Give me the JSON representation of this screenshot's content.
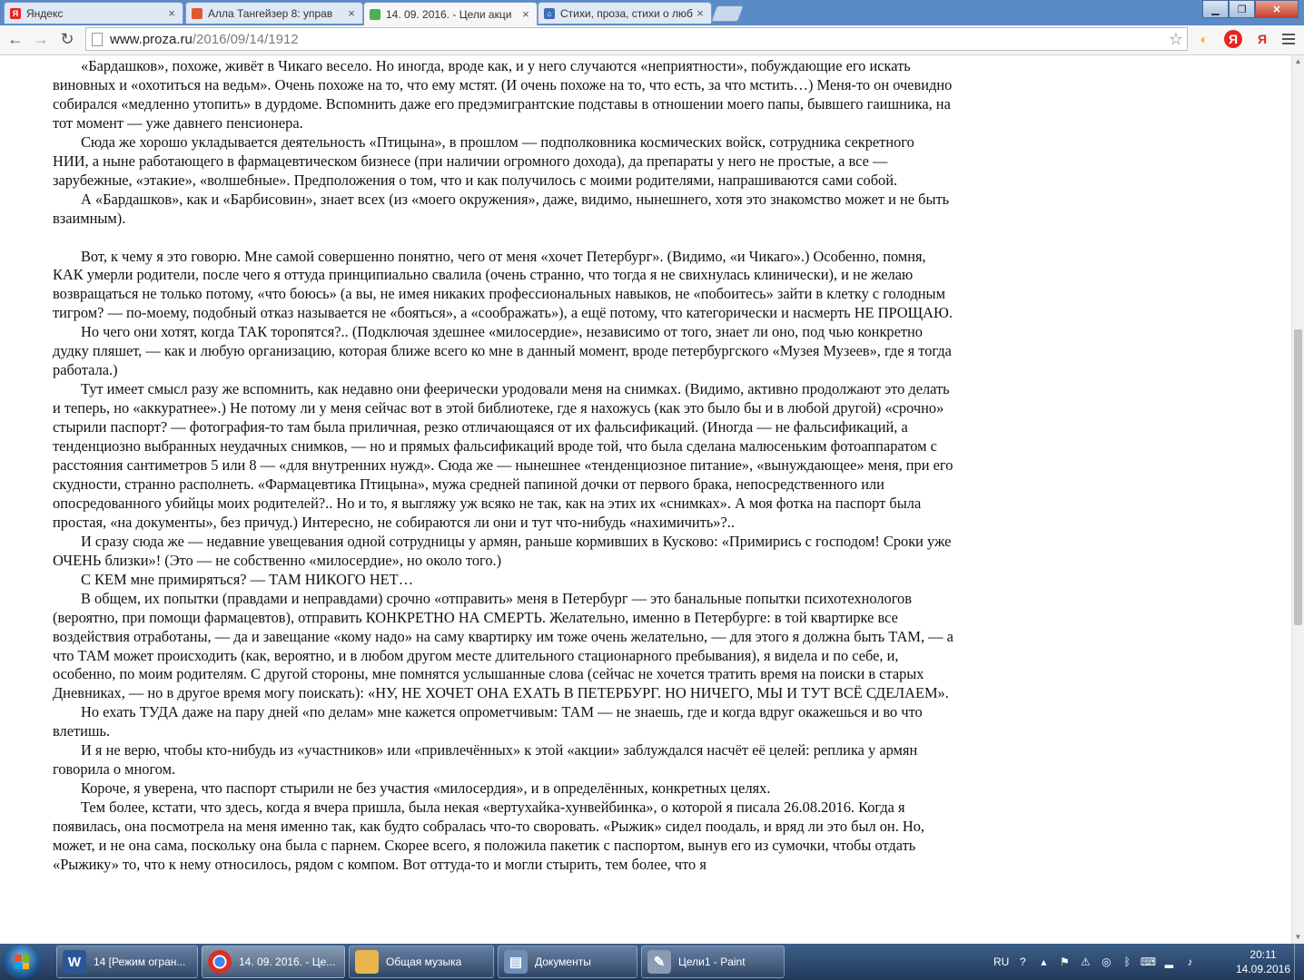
{
  "browser": {
    "tabs": [
      {
        "title": "Яндекс",
        "icon": "yandex-icon",
        "color": "#e52620",
        "active": false
      },
      {
        "title": "Алла Тангейзер 8: управ",
        "icon": "proza-icon",
        "color": "#e0582c",
        "active": false
      },
      {
        "title": "14. 09. 2016. - Цели акци",
        "icon": "proza-icon",
        "color": "#4caf50",
        "active": true
      },
      {
        "title": "Стихи, проза, стихи о люб",
        "icon": "home-icon",
        "color": "#3b6db3",
        "active": false
      }
    ],
    "url_host": "www.proza.ru",
    "url_path": "/2016/09/14/1912"
  },
  "article": {
    "paragraphs": [
      "«Бардашков», похоже, живёт в Чикаго весело. Но иногда, вроде как, и у него случаются «неприятности», побуждающие его искать виновных и «охотиться на ведьм». Очень похоже на то, что ему мстят. (И очень похоже на то, что есть, за что мстить…) Меня-то он очевидно собирался «медленно утопить» в дурдоме. Вспомнить даже его предэмигрантские подставы в отношении моего папы, бывшего гаишника, на тот момент — уже давнего пенсионера.",
      "Сюда же хорошо укладывается деятельность «Птицына», в прошлом — подполковника космических войск, сотрудника секретного НИИ, а ныне работающего в фармацевтическом бизнесе (при наличии огромного дохода), да препараты у него не простые, а все — зарубежные, «этакие», «волшебные». Предположения о том, что и как получилось с моими родителями, напрашиваются сами собой.",
      "А «Бардашков», как и «Барбисовин», знает всех (из «моего окружения», даже, видимо, нынешнего, хотя это знакомство может и не быть взаимным).",
      "",
      "Вот, к чему я это говорю. Мне самой совершенно понятно, чего от меня «хочет Петербург». (Видимо, «и Чикаго».) Особенно, помня, КАК умерли родители, после чего я оттуда принципиально свалила (очень странно, что тогда я не свихнулась клинически), и не желаю возвращаться не только потому, «что боюсь» (а вы, не имея никаких профессиональных навыков, не «побоитесь» зайти в клетку с голодным тигром? — по-моему, подобный отказ называется не «бояться», а «соображать»), а ещё потому, что категорически и насмерть НЕ ПРОЩАЮ.",
      "Но чего они хотят, когда ТАК торопятся?.. (Подключая здешнее «милосердие», независимо от того, знает ли оно, под чью конкретно дудку пляшет, — как и любую организацию, которая ближе всего ко мне в данный момент, вроде петербургского «Музея Музеев», где я тогда работала.)",
      "Тут имеет смысл разу же вспомнить, как недавно они феерически уродовали меня на снимках. (Видимо, активно продолжают это делать и теперь, но «аккуратнее».) Не потому ли у меня сейчас вот в этой библиотеке, где я нахожусь (как это было бы и в любой другой) «срочно» стырили паспорт? — фотография-то там была приличная, резко отличающаяся от их фальсификаций. (Иногда — не фальсификаций, а тенденциозно выбранных неудачных снимков, — но и прямых фальсификаций вроде той, что была сделана малюсеньким фотоаппаратом с расстояния сантиметров 5 или 8 — «для внутренних нужд». Сюда же — нынешнее «тенденциозное питание», «вынуждающее» меня, при его скудности, странно располнеть. «Фармацевтика Птицына», мужа средней папиной дочки от первого брака, непосредственного или опосредованного убийцы моих родителей?.. Но и то, я выгляжу уж всяко не так, как на этих их «снимках». А моя фотка на паспорт была простая, «на документы», без причуд.) Интересно, не собираются ли они и тут что-нибудь «нахимичить»?..",
      "И сразу сюда же — недавние увещевания одной сотрудницы у армян, раньше кормивших в Кусково: «Примирись с господом! Сроки уже ОЧЕНЬ близки»! (Это — не собственно «милосердие», но около того.)",
      "С КЕМ мне примиряться? — ТАМ НИКОГО НЕТ…",
      "В общем, их попытки (правдами и неправдами) срочно «отправить» меня в Петербург — это банальные попытки психотехнологов (вероятно, при помощи фармацевтов), отправить КОНКРЕТНО НА СМЕРТЬ. Желательно, именно в Петербурге: в той квартирке все воздействия отработаны, — да и завещание «кому надо» на саму квартирку им тоже очень желательно, — для этого я должна быть ТАМ, — а что ТАМ может происходить (как, вероятно, и в любом другом месте длительного стационарного пребывания), я видела и по себе, и, особенно, по моим родителям. С другой стороны, мне помнятся услышанные слова (сейчас не хочется тратить время на поиски в старых Дневниках, — но в другое время могу поискать): «НУ, НЕ ХОЧЕТ ОНА ЕХАТЬ В ПЕТЕРБУРГ. НО НИЧЕГО, МЫ И ТУТ ВСЁ СДЕЛАЕМ».",
      "Но ехать ТУДА даже на пару дней «по делам» мне кажется опрометчивым: ТАМ — не знаешь, где и когда вдруг окажешься и во что влетишь.",
      "И я не верю, чтобы кто-нибудь из «участников» или «привлечённых» к этой «акции» заблуждался насчёт её целей: реплика у армян говорила о многом.",
      "Короче, я уверена, что паспорт стырили не без участия «милосердия», и в определённых, конкретных целях.",
      "Тем более, кстати, что здесь, когда я вчера пришла, была некая «вертухайка-хунвейбинка», о которой я писала 26.08.2016. Когда я появилась, она посмотрела на меня именно так, как будто собралась что-то своровать. «Рыжик» сидел поодаль, и вряд ли это был он. Но, может, и не она сама, поскольку она была с парнем. Скорее всего, я положила пакетик с паспортом, вынув его из сумочки, чтобы отдать «Рыжику» то, что к нему относилось, рядом с компом. Вот оттуда-то и могли стырить, тем более, что я"
    ]
  },
  "taskbar": {
    "tasks": [
      {
        "label": "14 [Режим огран...",
        "icon": "word-icon",
        "color": "#2b5797",
        "glyph": "W"
      },
      {
        "label": "14. 09. 2016. - Це...",
        "icon": "chrome-icon",
        "color": "#d93025",
        "glyph": "●"
      },
      {
        "label": "Общая музыка",
        "icon": "folder-icon",
        "color": "#e8b64c",
        "glyph": "▮"
      },
      {
        "label": "Документы",
        "icon": "document-icon",
        "color": "#6d8fb8",
        "glyph": "▤"
      },
      {
        "label": "Цели1 - Paint",
        "icon": "paint-icon",
        "color": "#8b9bb4",
        "glyph": "✎"
      }
    ],
    "language": "RU",
    "time": "20:11",
    "date": "14.09.2016"
  }
}
